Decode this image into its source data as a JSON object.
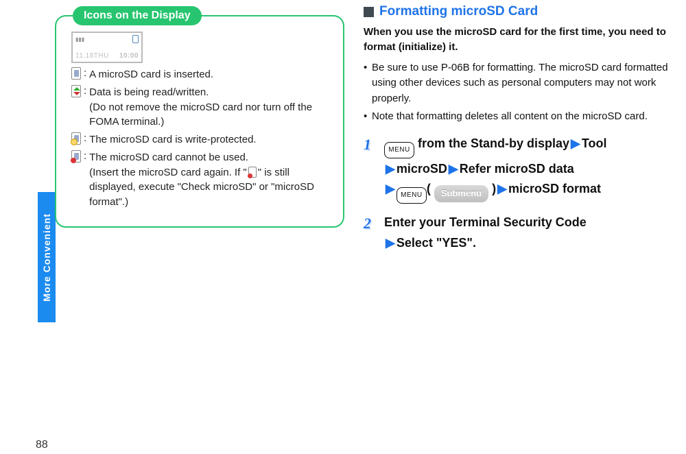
{
  "sidebar": {
    "tab_label": "More Convenient",
    "page_number": "88"
  },
  "left": {
    "box_title": "Icons on the Display",
    "phone": {
      "date": "11.18THU",
      "clock": "10:00"
    },
    "icons": {
      "inserted": "A microSD card is inserted.",
      "rw_line1": "Data is being read/written.",
      "rw_line2": "(Do not remove the microSD card nor turn off the FOMA terminal.)",
      "wp": "The microSD card is write-protected.",
      "err_line1": "The microSD card cannot be used.",
      "err_line2_a": "(Insert the microSD card again. If \"",
      "err_line2_b": "\" is still displayed, execute \"Check microSD\" or \"microSD format\".)"
    }
  },
  "right": {
    "heading": "Formatting microSD Card",
    "lead": "When you use the microSD card for the first time, you need to format (initialize) it.",
    "bullets": [
      "Be sure to use P-06B for formatting. The microSD card formatted using other devices such as personal computers may not work properly.",
      "Note that formatting deletes all content on the microSD card."
    ],
    "step1": {
      "menu_label": "MENU",
      "seg_from_standby": " from the Stand-by display",
      "tool": "Tool",
      "microsd": "microSD",
      "refer": "Refer microSD data",
      "submenu_pill": "Submenu",
      "microsd_format": "microSD format"
    },
    "step2": {
      "line1": "Enter your Terminal Security Code",
      "line2": "Select \"YES\"."
    }
  }
}
